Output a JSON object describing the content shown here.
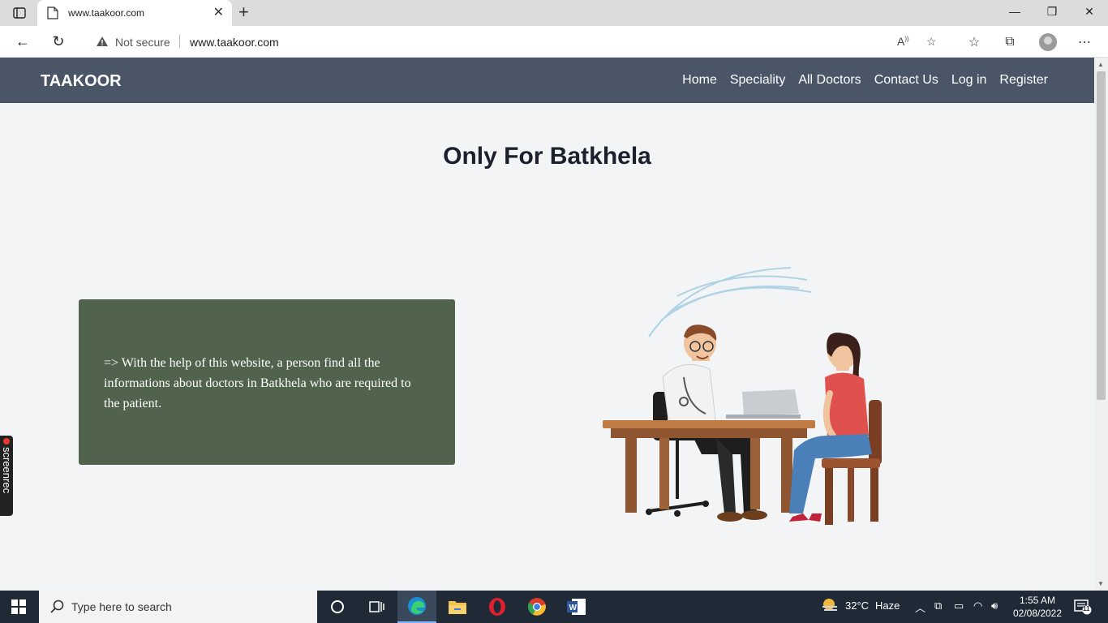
{
  "browser": {
    "tab": {
      "title": "www.taakoor.com"
    },
    "address": {
      "security_label": "Not secure",
      "url": "www.taakoor.com"
    }
  },
  "site": {
    "brand": "TAAKOOR",
    "nav": [
      "Home",
      "Speciality",
      "All Doctors",
      "Contact Us",
      "Log in",
      "Register"
    ],
    "heading": "Only For Batkhela",
    "info_text": "=> With the help of this website, a person find all the informations about doctors in Batkhela who are required to the patient.",
    "info_box_color": "#52634d",
    "navbar_color": "#4a5568"
  },
  "screenrec": {
    "label": "screenrec"
  },
  "taskbar": {
    "search_placeholder": "Type here to search",
    "weather": {
      "temp": "32°C",
      "condition": "Haze"
    },
    "clock": {
      "time": "1:55 AM",
      "date": "02/08/2022"
    },
    "notifications_count": "11"
  }
}
